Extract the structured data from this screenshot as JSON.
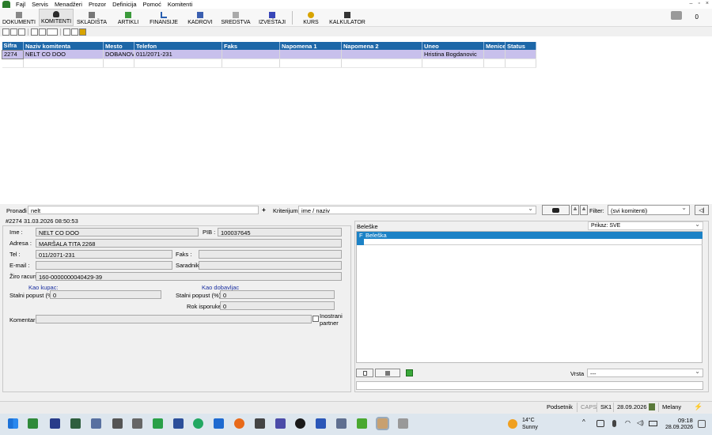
{
  "menu": [
    "Fajl",
    "Servis",
    "Menadžeri",
    "Prozor",
    "Definicija",
    "Pomoć",
    "Komitenti"
  ],
  "window_controls": [
    "–",
    "▫",
    "×"
  ],
  "toolbar": [
    {
      "label": "DOKUMENTI",
      "icon": "document-icon"
    },
    {
      "label": "KOMITENTI",
      "icon": "person-icon"
    },
    {
      "label": "SKLADIŠTA",
      "icon": "warehouse-icon"
    },
    {
      "label": "ARTIKLI",
      "icon": "box-icon"
    },
    {
      "label": "FINANSIJE",
      "icon": "chart-icon"
    },
    {
      "label": "KADROVI",
      "icon": "people-icon"
    },
    {
      "label": "SREDSTVA",
      "icon": "tools-icon"
    },
    {
      "label": "IZVEŠTAJI",
      "icon": "report-icon"
    },
    {
      "label": "KURS",
      "icon": "currency-icon"
    },
    {
      "label": "KALKULATOR",
      "icon": "calculator-icon"
    }
  ],
  "notification_count": "0",
  "grid": {
    "columns": [
      "Sifra",
      "Naziv komitenta",
      "Mesto",
      "Telefon",
      "Faks",
      "Napomena 1",
      "Napomena 2",
      "Uneo",
      "Menice",
      "Status"
    ],
    "rows": [
      [
        "2274",
        "NELT CO DOO",
        "DOBANOV",
        "011/2071-231",
        "",
        "",
        "",
        "Hristina Bogdanovic",
        "",
        ""
      ]
    ]
  },
  "search": {
    "label": "Pronađi",
    "value": "nelt",
    "plus": "+",
    "criteria_label": "Kriterijum",
    "criteria_value": "ime / naziv",
    "filter_label": "Filter:",
    "filter_value": "(svi komitenti)"
  },
  "record": {
    "header": "#2274  31.03.2026 08:50:53",
    "ime_label": "Ime :",
    "ime": "NELT CO DOO",
    "pib_label": "PIB :",
    "pib": "100037645",
    "adresa_label": "Adresa :",
    "adresa": "MARŠALA TITA 2268",
    "tel_label": "Tel :",
    "tel": "011/2071-231",
    "faks_label": "Faks :",
    "faks": "",
    "email_label": "E-mail :",
    "email": "",
    "saradnik_label": "Saradnik :",
    "saradnik": "",
    "ziro_label": "Žiro racun :",
    "ziro": "160-0000000040429-39",
    "kupac_heading": "Kao kupac:",
    "dobavljac_heading": "Kao dobavljac",
    "popust_kupac_label": "Stalni popust (%)",
    "popust_kupac": "0",
    "popust_dob_label": "Stalni popust (%) :",
    "popust_dob": "0",
    "rok_label": "Rok isporuke:",
    "rok": "0",
    "komentar_label": "Komentar",
    "komentar": "",
    "inostrani_label_1": "Inostrani",
    "inostrani_label_2": "partner"
  },
  "notes": {
    "title": "Beleške",
    "prikaz": "Prikaz: SVE",
    "col_flag": "F",
    "col_name": "Beleška",
    "vrsta_label": "Vrsta",
    "vrsta_value": "---"
  },
  "status": {
    "podsetnik": "Podsetnik",
    "caps": "CAPS",
    "sk": "SK1",
    "date": "28.09.2026",
    "user": "Melany"
  },
  "taskbar": {
    "weather_temp": "14°C",
    "weather_desc": "Sunny",
    "time": "09:18",
    "date": "28.09.2026",
    "tray_chevron": "^"
  },
  "colors": {
    "header_blue": "#1d67a8",
    "selected_row": "#c8c0ec",
    "note_blue": "#1c82c6"
  }
}
